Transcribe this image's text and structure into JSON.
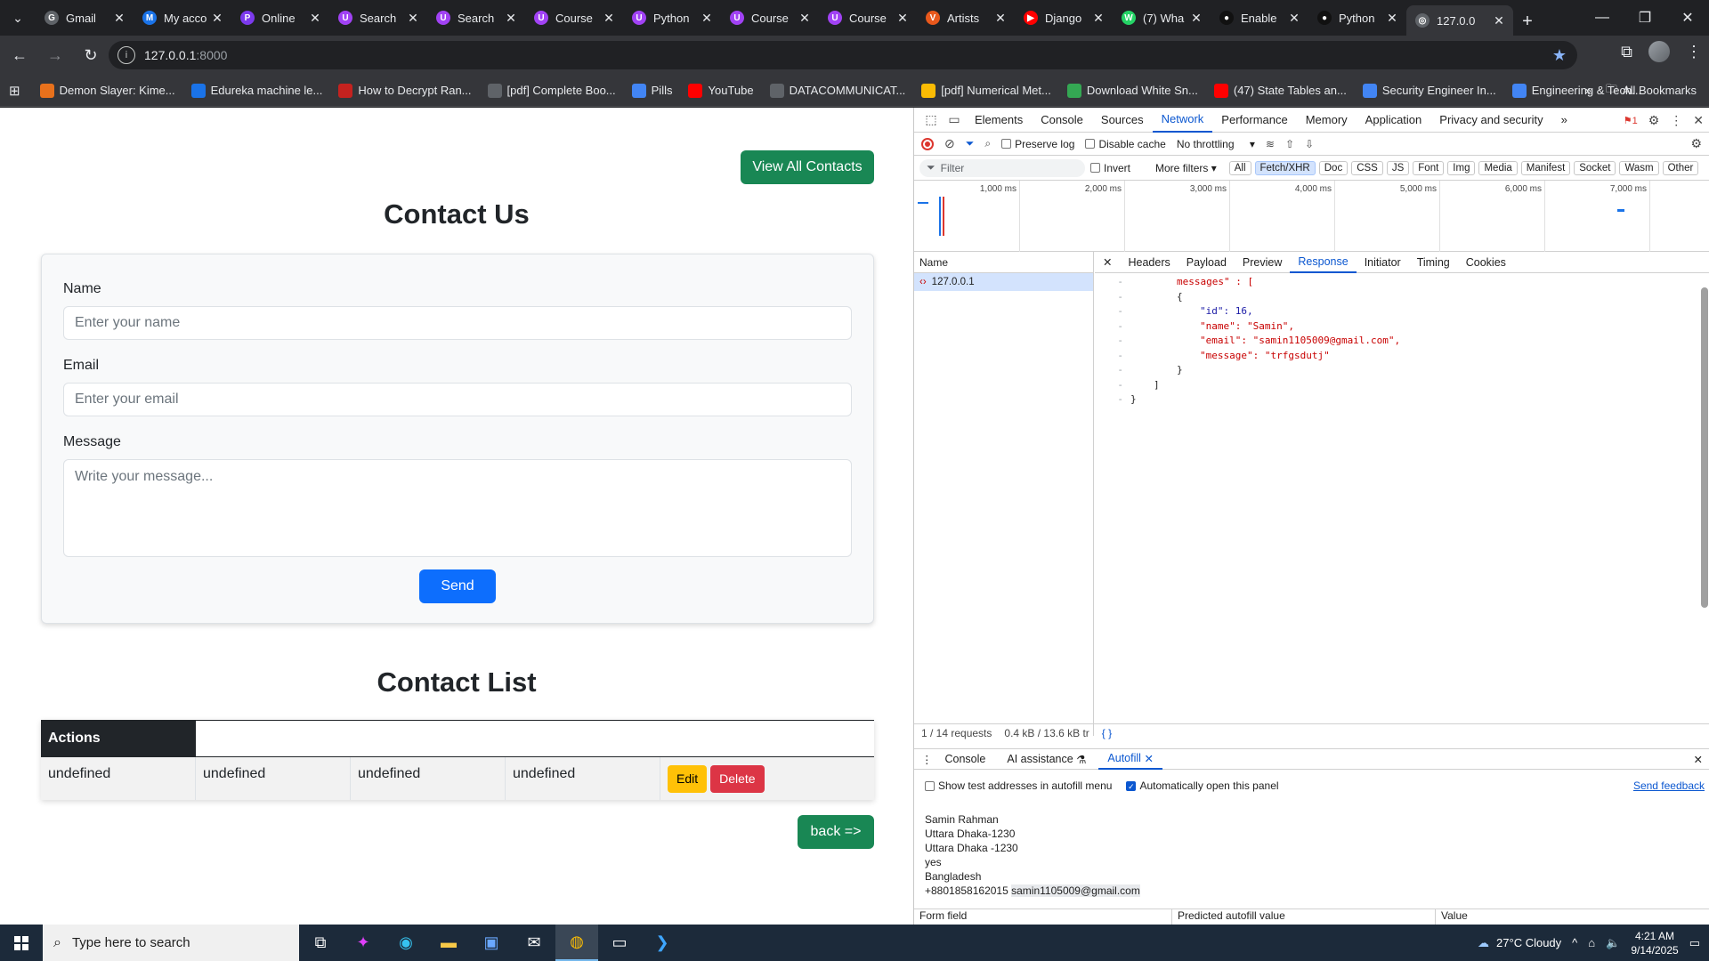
{
  "browser": {
    "tabs": [
      {
        "title": "Gmail",
        "color": "#5f6368",
        "glyph": "G"
      },
      {
        "title": "My acco",
        "color": "#1a73e8",
        "glyph": "M"
      },
      {
        "title": "Online",
        "color": "#7c3aed",
        "glyph": "P"
      },
      {
        "title": "Search",
        "color": "#a142f4",
        "glyph": "U"
      },
      {
        "title": "Search",
        "color": "#a142f4",
        "glyph": "U"
      },
      {
        "title": "Course",
        "color": "#a142f4",
        "glyph": "U"
      },
      {
        "title": "Python",
        "color": "#a142f4",
        "glyph": "U"
      },
      {
        "title": "Course",
        "color": "#a142f4",
        "glyph": "U"
      },
      {
        "title": "Course",
        "color": "#a142f4",
        "glyph": "U"
      },
      {
        "title": "Artists",
        "color": "#e8581c",
        "glyph": "V"
      },
      {
        "title": "Django",
        "color": "#ff0000",
        "glyph": "▶"
      },
      {
        "title": "(7) Wha",
        "color": "#25d366",
        "glyph": "W"
      },
      {
        "title": "Enable",
        "color": "#111111",
        "glyph": "●"
      },
      {
        "title": "Python",
        "color": "#111111",
        "glyph": "●"
      },
      {
        "title": "127.0.0",
        "color": "#5f6368",
        "glyph": "◎"
      }
    ],
    "url_host": "127.0.0.1",
    "url_port": ":8000",
    "bookmarks": [
      {
        "label": "Demon Slayer: Kime...",
        "color": "#e8711c"
      },
      {
        "label": "Edureka machine le...",
        "color": "#1a73e8"
      },
      {
        "label": "How to Decrypt Ran...",
        "color": "#c5221f"
      },
      {
        "label": "[pdf] Complete Boo...",
        "color": "#5f6368"
      },
      {
        "label": "Pills",
        "color": "#4285f4"
      },
      {
        "label": "YouTube",
        "color": "#ff0000"
      },
      {
        "label": "DATACOMMUNICAT...",
        "color": "#5f6368"
      },
      {
        "label": "[pdf] Numerical Met...",
        "color": "#fbbc04"
      },
      {
        "label": "Download White Sn...",
        "color": "#34a853"
      },
      {
        "label": "(47) State Tables an...",
        "color": "#ff0000"
      },
      {
        "label": "Security Engineer In...",
        "color": "#4285f4"
      },
      {
        "label": "Engineering & Tech...",
        "color": "#4285f4"
      }
    ],
    "all_bookmarks": "All Bookmarks"
  },
  "page": {
    "view_all_label": "View All Contacts",
    "contact_us_title": "Contact Us",
    "form": {
      "name_label": "Name",
      "name_placeholder": "Enter your name",
      "email_label": "Email",
      "email_placeholder": "Enter your email",
      "message_label": "Message",
      "message_placeholder": "Write your message...",
      "send_label": "Send"
    },
    "contact_list_title": "Contact List",
    "table": {
      "actions_header": "Actions",
      "row": [
        "undefined",
        "undefined",
        "undefined",
        "undefined"
      ],
      "edit_label": "Edit",
      "delete_label": "Delete"
    },
    "back_label": "back =>"
  },
  "devtools": {
    "tabs": [
      "Elements",
      "Console",
      "Sources",
      "Network",
      "Performance",
      "Memory",
      "Application",
      "Privacy and security"
    ],
    "error_count": "1",
    "preserve_log": "Preserve log",
    "disable_cache": "Disable cache",
    "throttling": "No throttling",
    "filter_placeholder": "Filter",
    "invert": "Invert",
    "more_filters": "More filters",
    "filter_types": [
      "All",
      "Fetch/XHR",
      "Doc",
      "CSS",
      "JS",
      "Font",
      "Img",
      "Media",
      "Manifest",
      "Socket",
      "Wasm",
      "Other"
    ],
    "timeline_ticks": [
      "1,000 ms",
      "2,000 ms",
      "3,000 ms",
      "4,000 ms",
      "5,000 ms",
      "6,000 ms",
      "7,000 ms"
    ],
    "name_header": "Name",
    "request_name": "127.0.0.1",
    "detail_tabs": [
      "Headers",
      "Payload",
      "Preview",
      "Response",
      "Initiator",
      "Timing",
      "Cookies"
    ],
    "response_lines": [
      "messages\" : [",
      "{",
      "\"id\": 16,",
      "\"name\": \"Samin\",",
      "\"email\": \"samin1105009@gmail.com\",",
      "\"message\": \"trfgsdutj\"",
      "}",
      "]",
      "}"
    ],
    "status_requests": "1 / 14 requests",
    "status_size": "0.4 kB / 13.6 kB tr",
    "drawer_tabs": [
      "Console",
      "AI assistance",
      "Autofill"
    ],
    "show_test_addresses": "Show test addresses in autofill menu",
    "auto_open": "Automatically open this panel",
    "send_feedback": "Send feedback",
    "address_lines": [
      "Samin Rahman",
      "Uttara Dhaka-1230",
      "Uttara Dhaka -1230",
      "yes",
      "Bangladesh"
    ],
    "phone": "+8801858162015",
    "email_highlight": "samin1105009@gmail.com",
    "table_headers": [
      "Form field",
      "Predicted autofill value",
      "Value"
    ]
  },
  "taskbar": {
    "search_placeholder": "Type here to search",
    "weather": "27°C  Cloudy",
    "time": "4:21 AM",
    "date": "9/14/2025"
  }
}
